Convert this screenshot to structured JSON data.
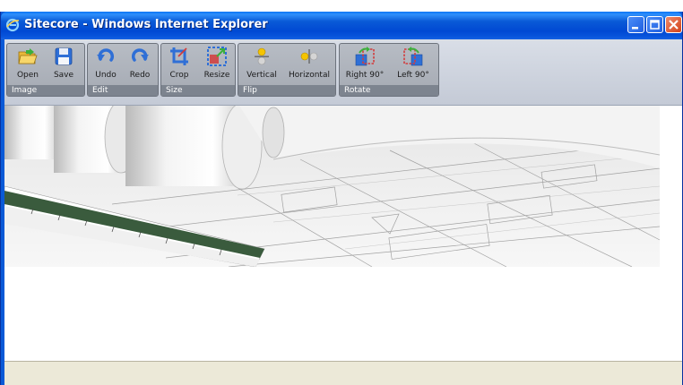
{
  "window": {
    "title": "Sitecore - Windows Internet Explorer",
    "icon": "ie-icon",
    "controls": [
      "minimize-icon",
      "maximize-icon",
      "close-icon"
    ]
  },
  "toolbar": {
    "groups": [
      {
        "label": "Image",
        "buttons": [
          {
            "label": "Open",
            "icon": "folder-open-icon"
          },
          {
            "label": "Save",
            "icon": "floppy-disk-icon"
          }
        ]
      },
      {
        "label": "Edit",
        "buttons": [
          {
            "label": "Undo",
            "icon": "undo-icon"
          },
          {
            "label": "Redo",
            "icon": "redo-icon"
          }
        ]
      },
      {
        "label": "Size",
        "buttons": [
          {
            "label": "Crop",
            "icon": "crop-icon"
          },
          {
            "label": "Resize",
            "icon": "resize-icon"
          }
        ]
      },
      {
        "label": "Flip",
        "buttons": [
          {
            "label": "Vertical",
            "icon": "flip-vertical-icon"
          },
          {
            "label": "Horizontal",
            "icon": "flip-horizontal-icon"
          }
        ]
      },
      {
        "label": "Rotate",
        "buttons": [
          {
            "label": "Right 90°",
            "icon": "rotate-right-icon"
          },
          {
            "label": "Left 90°",
            "icon": "rotate-left-icon"
          }
        ]
      }
    ]
  },
  "colors": {
    "titlebar": "#0a5ad7",
    "toolbar_bg": "#c4cad6",
    "group_bg": "#a5aab3",
    "group_label_bg": "#7d848f",
    "icon_blue": "#2f6fd6",
    "icon_yellow": "#f5c400"
  },
  "image": {
    "description_icon": "blueprint-image"
  }
}
